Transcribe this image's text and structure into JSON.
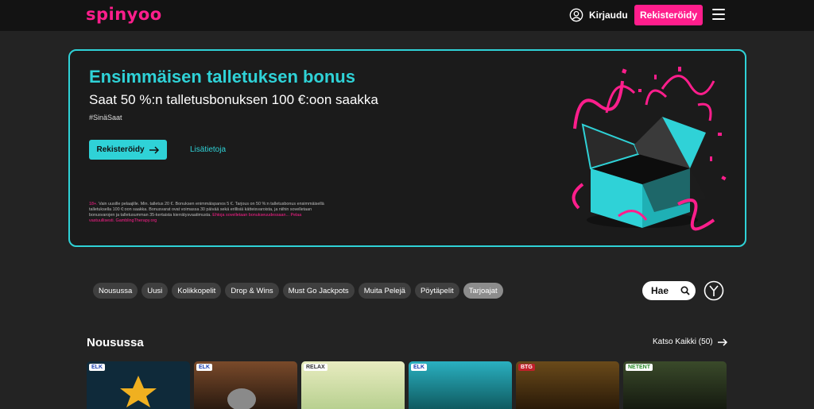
{
  "header": {
    "logo": "spinyoo",
    "login_label": "Kirjaudu",
    "register_label": "Rekisteröidy"
  },
  "banner": {
    "title": "Ensimmäisen talletuksen bonus",
    "subtitle": "Saat 50 %:n talletusbonuksen 100 €:oon saakka",
    "tag": "#SinäSaat",
    "register_label": "Rekisteröidy",
    "more_label": "Lisätietoja",
    "terms_lead": "18+.",
    "terms_text": "Vain uusille pelaajille. Min. talletus 20 €. Bonuksen enimmäispanos 5 €. Tarjous on 50 %:n talletusbonus ensimmäisellä talletuksella 100 €:oon saakka. Bonusvarat ovat voimassa 30 päivää sekä erillisiä kätteisvaroista, ja niihin sovelletaan bonusvarojen ja talletusumman 35-kertaista kierrätysvaatimusta.",
    "terms_links": "Ehtoja sovelletaan bonukseuudessaan... Pelaa vastuullisesti. GamblingTherapy.org"
  },
  "filters": [
    {
      "label": "Nousussa",
      "active": false
    },
    {
      "label": "Uusi",
      "active": false
    },
    {
      "label": "Kolikkopelit",
      "active": false
    },
    {
      "label": "Drop & Wins",
      "active": false
    },
    {
      "label": "Must Go Jackpots",
      "active": false
    },
    {
      "label": "Muita Pelejä",
      "active": false
    },
    {
      "label": "Pöytäpelit",
      "active": false
    },
    {
      "label": "Tarjoajat",
      "active": true
    }
  ],
  "search": {
    "label": "Hae"
  },
  "section": {
    "title": "Nousussa",
    "see_all": "Katso Kaikki (50)"
  },
  "tiles": [
    {
      "provider": "ELK",
      "bg": "#0f2a3a"
    },
    {
      "provider": "ELK",
      "bg": "#3a2a1a"
    },
    {
      "provider": "RELAX",
      "bg": "#d8e4b0"
    },
    {
      "provider": "ELK",
      "bg": "#1a8a9a"
    },
    {
      "provider": "BTG",
      "bg": "#4a3010"
    },
    {
      "provider": "NETENT",
      "bg": "#1e2a1a"
    }
  ],
  "colors": {
    "brand_pink": "#ff1e8c",
    "accent_cyan": "#2fd2d7",
    "background": "#232323"
  }
}
